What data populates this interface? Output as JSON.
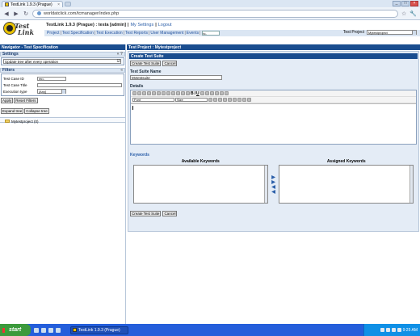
{
  "browser": {
    "tab_title": "TestLink 1.9.3 (Prague)",
    "tab_close": "×",
    "url": "worldatclick.com/tcmanager/index.php",
    "win_min": "_",
    "win_max": "□",
    "win_close": "×",
    "star": "☆",
    "wrench": "🔧",
    "back": "◀",
    "forward": "▶",
    "reload": "↻"
  },
  "app": {
    "logo_line1": "Test",
    "logo_line2": "Link",
    "version_user": "TestLink 1.9.3 (Prague) : testa [admin]",
    "my_settings": "My Settings",
    "logout": "Logout",
    "sep": "|",
    "menu": [
      "Project",
      "Test Specification",
      "Test Execution",
      "Test Reports",
      "User Management",
      "Events"
    ],
    "menu_input": "tc-",
    "test_project_label": "Test Project",
    "test_project_value": "Mytestproject"
  },
  "left": {
    "title": "Navigator - Test Specification",
    "settings_label": "Settings",
    "settings_ctrl": "« ?",
    "settings_option": "Update tree after every operation",
    "settings_check": "☑",
    "filters_label": "Filters",
    "filters_ctrl": "«",
    "tc_id_label": "Test Case ID",
    "tc_id_value": "mp-",
    "tc_title_label": "Test Case Title",
    "tc_title_value": "",
    "exec_type_label": "Execution type",
    "exec_type_value": "[Any]",
    "apply_btn": "Apply",
    "reset_btn": "Reset Filters",
    "expand_btn": "Expand tree",
    "collapse_btn": "Collapse tree",
    "tree_node": "Mytestproject (0)"
  },
  "right": {
    "title": "Test Project : Mytestproject",
    "subtitle": "Create Test Suite",
    "create_btn": "Create Test Suite",
    "cancel_btn": "Cancel",
    "suite_name_label": "Test Suite Name",
    "suite_name_value": "Mytestsuite",
    "details_label": "Details",
    "font_label": "Font",
    "size_label": "Size",
    "bold": "B",
    "italic": "I",
    "underline": "U",
    "keywords_label": "Keywords",
    "available_kw": "Available Keywords",
    "assigned_kw": "Assigned Keywords",
    "arrows": [
      "▶",
      "▶",
      "◀",
      "◀"
    ],
    "create_btn2": "Create Test Suite",
    "cancel_btn2": "Cancel"
  },
  "taskbar": {
    "start": "start",
    "app": "TestLink 1.9.3 (Prague)",
    "clock": "9:25 AM"
  }
}
